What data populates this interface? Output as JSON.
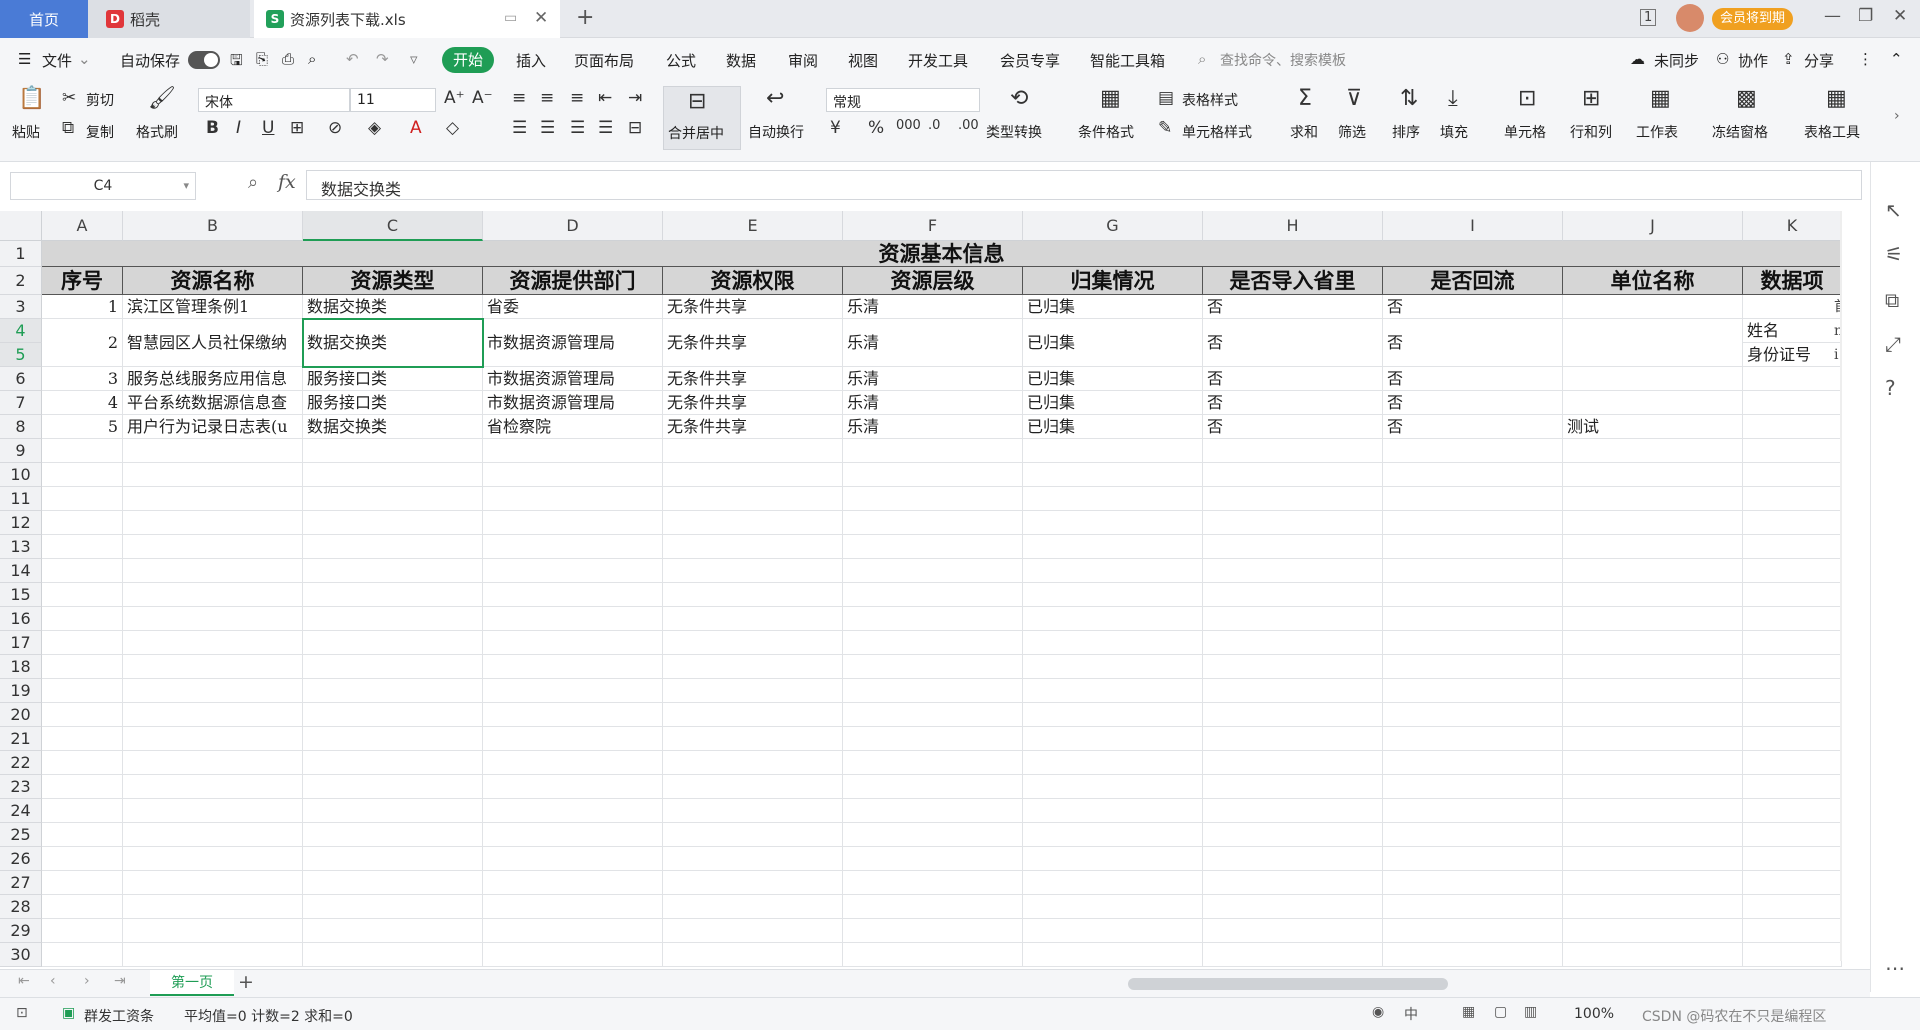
{
  "tabs": {
    "home": "首页",
    "daoke": "稻壳",
    "file": "资源列表下载.xls",
    "member_badge": "会员将到期"
  },
  "menubar": {
    "file": "文件",
    "autosave": "自动保存",
    "start": "开始",
    "items": [
      "插入",
      "页面布局",
      "公式",
      "数据",
      "审阅",
      "视图",
      "开发工具",
      "会员专享",
      "智能工具箱"
    ],
    "search_placeholder": "查找命令、搜索模板",
    "unsync": "未同步",
    "collab": "协作",
    "share": "分享"
  },
  "ribbon": {
    "paste": "粘贴",
    "cut": "剪切",
    "copy": "复制",
    "format_painter": "格式刷",
    "font_name": "宋体",
    "font_size": "11",
    "merge": "合并居中",
    "wrap": "自动换行",
    "number_format": "常规",
    "type_convert": "类型转换",
    "cond_format": "条件格式",
    "table_style": "表格样式",
    "cell_style": "单元格样式",
    "sum": "求和",
    "filter": "筛选",
    "sort": "排序",
    "fill": "填充",
    "cell": "单元格",
    "rowcol": "行和列",
    "worksheet": "工作表",
    "freeze": "冻结窗格",
    "table_tools": "表格工具"
  },
  "formula": {
    "namebox": "C4",
    "fx": "fx",
    "content": "数据交换类"
  },
  "columns": [
    "A",
    "B",
    "C",
    "D",
    "E",
    "F",
    "G",
    "H",
    "I",
    "J",
    "K"
  ],
  "rows": [
    "1",
    "2",
    "3",
    "4",
    "5",
    "6",
    "7",
    "8",
    "9",
    "10",
    "11",
    "12",
    "13",
    "14",
    "15",
    "16",
    "17",
    "18",
    "19",
    "20",
    "21",
    "22",
    "23",
    "24",
    "25",
    "26",
    "27",
    "28",
    "29",
    "30"
  ],
  "sheet": {
    "title": "资源基本信息",
    "headers": [
      "序号",
      "资源名称",
      "资源类型",
      "资源提供部门",
      "资源权限",
      "资源层级",
      "归集情况",
      "是否导入省里",
      "是否回流",
      "单位名称",
      "数据项"
    ],
    "records": [
      [
        "1",
        "滨江区管理条例1",
        "数据交换类",
        "省委",
        "无条件共享",
        "乐清",
        "已归集",
        "否",
        "否",
        ""
      ],
      [
        "2",
        "智慧园区人员社保缴纳",
        "数据交换类",
        "市数据资源管理局",
        "无条件共享",
        "乐清",
        "已归集",
        "否",
        "否",
        ""
      ],
      [
        "3",
        "服务总线服务应用信息",
        "服务接口类",
        "市数据资源管理局",
        "无条件共享",
        "乐清",
        "已归集",
        "否",
        "否",
        ""
      ],
      [
        "4",
        "平台系统数据源信息查",
        "服务接口类",
        "市数据资源管理局",
        "无条件共享",
        "乐清",
        "已归集",
        "否",
        "否",
        ""
      ],
      [
        "5",
        "用户行为记录日志表(u",
        "数据交换类",
        "省检察院",
        "无条件共享",
        "乐清",
        "已归集",
        "否",
        "否",
        "测试"
      ]
    ],
    "k_row4": "姓名",
    "k_row5": "身份证号",
    "l_row3": "首",
    "l_row4": "n",
    "l_row5": "i"
  },
  "sheet_tabs": {
    "active": "第一页"
  },
  "status": {
    "app": "群发工资条",
    "stats": "平均值=0  计数=2  求和=0",
    "zoom": "100%",
    "watermark": "CSDN @码农在不只是编程区"
  },
  "colors": {
    "accent_green": "#1f9d55",
    "home_tab": "#4a7bd6",
    "selection": "#1f9d55",
    "header_fill": "#d6d6d6"
  }
}
